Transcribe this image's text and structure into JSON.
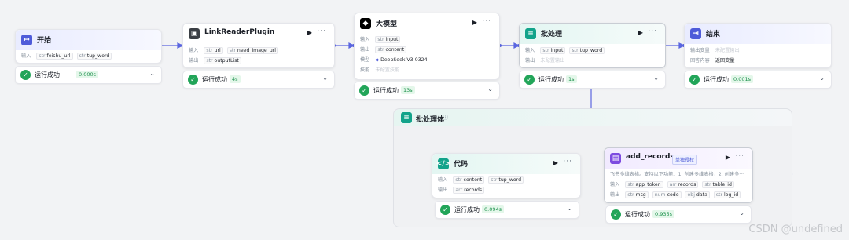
{
  "colors": {
    "accent": "#4e5bd9",
    "success": "#22a559",
    "code_icon": "#12a38a",
    "purple_icon": "#7d4be0"
  },
  "nodes": {
    "start": {
      "title": "开始",
      "input_label": "输入",
      "inputs": [
        {
          "type": "str",
          "name": "feishu_url"
        },
        {
          "type": "str",
          "name": "tup_word"
        }
      ],
      "status": "运行成功",
      "time": "0.000s"
    },
    "link_reader": {
      "title": "LinkReaderPlugin",
      "input_label": "输入",
      "inputs": [
        {
          "type": "str",
          "name": "url"
        },
        {
          "type": "str",
          "name": "need_image_url"
        }
      ],
      "output_label": "输出",
      "outputs": [
        {
          "type": "str",
          "name": "outputList"
        }
      ],
      "status": "运行成功",
      "time": "4s"
    },
    "llm": {
      "title": "大模型",
      "input_label": "输入",
      "inputs": [
        {
          "type": "str",
          "name": "input"
        }
      ],
      "output_label": "输出",
      "outputs": [
        {
          "type": "str",
          "name": "content"
        }
      ],
      "model_label": "模型",
      "model": "DeepSeek-V3-0324",
      "skill_label": "技能",
      "skill": "未配置技能",
      "status": "运行成功",
      "time": "13s"
    },
    "batch": {
      "title": "批处理",
      "input_label": "输入",
      "inputs": [
        {
          "type": "str",
          "name": "input"
        },
        {
          "type": "str",
          "name": "tup_word"
        }
      ],
      "output_label": "输出",
      "output_empty": "未配置输出",
      "status": "运行成功",
      "time": "1s"
    },
    "end": {
      "title": "结束",
      "output_label": "输出变量",
      "output_empty": "未配置输出",
      "answer_label": "回答内容",
      "answer": "返回变量",
      "status": "运行成功",
      "time": "0.001s"
    },
    "batch_body": {
      "title": "批处理体"
    },
    "code": {
      "title": "代码",
      "input_label": "输入",
      "inputs": [
        {
          "type": "str",
          "name": "content"
        },
        {
          "type": "str",
          "name": "tup_word"
        }
      ],
      "output_label": "输出",
      "outputs": [
        {
          "type": "arr",
          "name": "records"
        }
      ],
      "status": "运行成功",
      "time": "0.094s"
    },
    "add_records": {
      "title": "add_records",
      "badge": "单独授权",
      "desc": "飞书多维表格。支持以下功能：1. 创建多维表格；2. 创建多···",
      "input_label": "输入",
      "inputs": [
        {
          "type": "str",
          "name": "app_token"
        },
        {
          "type": "arr",
          "name": "records"
        },
        {
          "type": "str",
          "name": "table_id"
        }
      ],
      "output_label": "输出",
      "outputs": [
        {
          "type": "str",
          "name": "msg"
        },
        {
          "type": "num",
          "name": "code"
        },
        {
          "type": "obj",
          "name": "data"
        },
        {
          "type": "str",
          "name": "log_id"
        }
      ],
      "status": "运行成功",
      "time": "0.935s"
    }
  },
  "icons": {
    "start": "login-icon",
    "end": "exit-icon",
    "run": "play-icon",
    "more": "ellipsis-icon",
    "ok": "check-circle-icon",
    "chevron": "chevron-down-icon"
  },
  "watermark": "CSDN @undefined"
}
